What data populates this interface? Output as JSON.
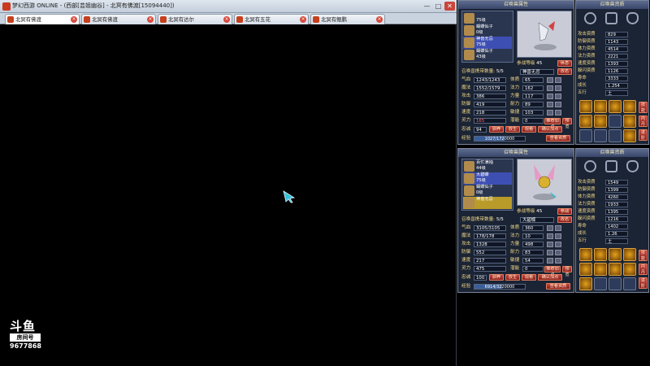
{
  "window": {
    "title": "梦幻西游 ONLINE - (西部[芸姐幽谷] - 北冥有佛渡[15094440])",
    "min_btn": "—",
    "max_btn": "□",
    "close_btn": "✕"
  },
  "tabs": [
    {
      "label": "北冥有佛渡"
    },
    {
      "label": "北冥有佛渡"
    },
    {
      "label": "北冥有达尔"
    },
    {
      "label": "北冥有五花"
    },
    {
      "label": "北冥有鲲鹏"
    }
  ],
  "stream": {
    "brand": "斗鱼",
    "room_label": "房间号",
    "room_number": "9677868"
  },
  "panels": [
    {
      "header": "召唤兽属性",
      "right_header": "召唤兽资质",
      "pets": [
        {
          "name": "",
          "level": "75级"
        },
        {
          "name": "蝴蝶仙子",
          "level": "0级"
        },
        {
          "name": "神兽无忌",
          "level": "75级"
        },
        {
          "name": "蝴蝶仙子",
          "level": "43级"
        }
      ],
      "battle_level_label": "参战等级",
      "battle_level": "45",
      "rest_btn": "休息",
      "pet_name": "神兽无忌",
      "rename_btn": "改名",
      "count_label": "召唤兽携带数量:",
      "count": "5/5",
      "stats_left": [
        {
          "label": "气血",
          "value": "1243/1243"
        },
        {
          "label": "魔法",
          "value": "1552/1579"
        },
        {
          "label": "攻击",
          "value": "386"
        },
        {
          "label": "防御",
          "value": "419"
        },
        {
          "label": "速度",
          "value": "218"
        },
        {
          "label": "灵力",
          "value": "165"
        }
      ],
      "stats_right": [
        {
          "label": "体质",
          "value": "65"
        },
        {
          "label": "法力",
          "value": "162"
        },
        {
          "label": "力量",
          "value": "117"
        },
        {
          "label": "耐力",
          "value": "89"
        },
        {
          "label": "敏捷",
          "value": "103"
        },
        {
          "label": "潜能",
          "value": "0"
        }
      ],
      "buttons": [
        "推荐加点",
        "预览"
      ],
      "loyalty_label": "忠诚",
      "loyalty": "94",
      "bottom_buttons": [
        "驯养",
        "放生",
        "观看",
        "确认加点"
      ],
      "exp_label": "经验",
      "exp_text": "1027/1720000",
      "exp_fraction": 0.6,
      "equip_btn": "查看资质",
      "apt_labels": [
        "攻击资质",
        "防御资质",
        "体力资质",
        "法力资质",
        "速度资质",
        "躲闪资质",
        "寿命",
        "成长",
        "五行"
      ],
      "apt_values": [
        "829",
        "1143",
        "4514",
        "2221",
        "1393",
        "1126",
        "3333",
        "1.254",
        "土"
      ],
      "side_btns": [
        "技能",
        "内丹",
        "进阶"
      ]
    },
    {
      "header": "召唤兽属性",
      "right_header": "召唤兽资质",
      "pets": [
        {
          "name": "百忙满袖",
          "level": "44级"
        },
        {
          "name": "大碧蝶",
          "level": "75级"
        },
        {
          "name": "蝴蝶仙子",
          "level": "0级"
        },
        {
          "name": "神兽无忌",
          "level": ""
        }
      ],
      "battle_level_label": "参战等级",
      "battle_level": "45",
      "rest_btn": "参战",
      "pet_name": "大碧蝶",
      "rename_btn": "改名",
      "count_label": "召唤兽携带数量:",
      "count": "5/5",
      "stats_left": [
        {
          "label": "气血",
          "value": "3105/3105"
        },
        {
          "label": "魔法",
          "value": "178/178"
        },
        {
          "label": "攻击",
          "value": "1328"
        },
        {
          "label": "防御",
          "value": "552"
        },
        {
          "label": "速度",
          "value": "217"
        },
        {
          "label": "灵力",
          "value": "475"
        }
      ],
      "stats_right": [
        {
          "label": "体质",
          "value": "360"
        },
        {
          "label": "法力",
          "value": "10"
        },
        {
          "label": "力量",
          "value": "498"
        },
        {
          "label": "耐力",
          "value": "83"
        },
        {
          "label": "敏捷",
          "value": "54"
        },
        {
          "label": "潜能",
          "value": "0"
        }
      ],
      "buttons": [
        "推荐加点",
        "预览"
      ],
      "loyalty_label": "忠诚",
      "loyalty": "100",
      "bottom_buttons": [
        "驯养",
        "放生",
        "观看",
        "确认加点"
      ],
      "exp_label": "经验",
      "exp_text": "6914/3220000",
      "exp_fraction": 0.55,
      "equip_btn": "查看资质",
      "apt_labels": [
        "攻击资质",
        "防御资质",
        "体力资质",
        "法力资质",
        "速度资质",
        "躲闪资质",
        "寿命",
        "成长",
        "五行"
      ],
      "apt_values": [
        "1549",
        "1399",
        "4260",
        "1933",
        "1395",
        "1216",
        "1402",
        "1.26",
        "土"
      ],
      "side_btns": [
        "技能",
        "内丹",
        "进阶"
      ]
    }
  ]
}
